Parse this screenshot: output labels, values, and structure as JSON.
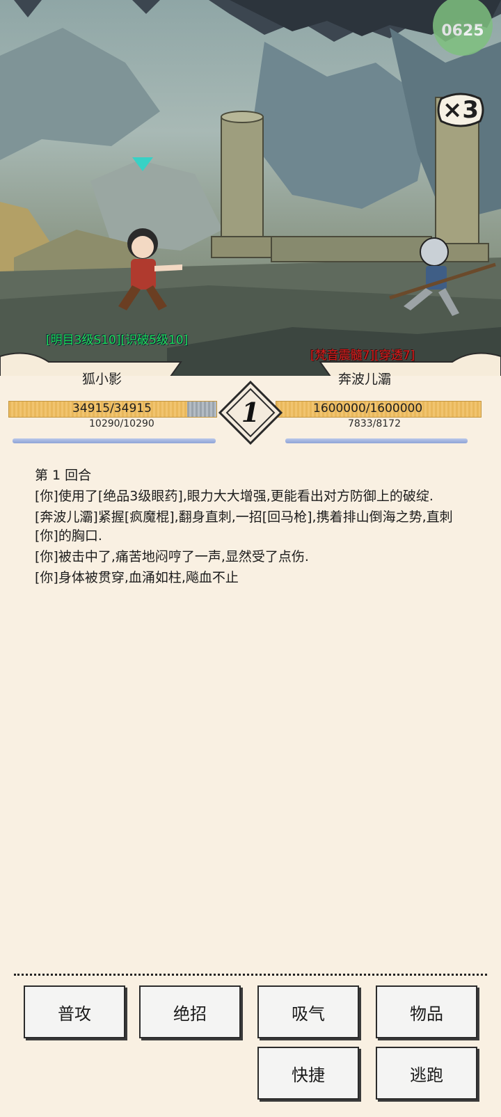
{
  "scene": {
    "speed_multiplier": "×3",
    "timer_text": "0625",
    "player_buffs": "[明目3级S10][识破5级10]",
    "enemy_buffs": "[梵音震髓7][穿透7]"
  },
  "player": {
    "name": "狐小影",
    "hp": "34915/34915",
    "hp_fraction": 0.86,
    "mp": "10290/10290",
    "mp_fraction": 1.0
  },
  "enemy": {
    "name": "奔波儿灞",
    "hp": "1600000/1600000",
    "hp_fraction": 1.0,
    "mp": "7833/8172",
    "mp_fraction": 0.96
  },
  "round": "1",
  "log": [
    "第 1 回合",
    "[你]使用了[绝品3级眼药],眼力大大增强,更能看出对方防御上的破绽.",
    "[奔波儿灞]紧握[疯魔棍],翻身直刺,一招[回马枪],携着排山倒海之势,直刺[你]的胸口.",
    "[你]被击中了,痛苦地闷哼了一声,显然受了点伤.",
    "[你]身体被贯穿,血涌如柱,飚血不止"
  ],
  "buttons": {
    "attack": "普攻",
    "ultimate": "绝招",
    "breathe": "吸气",
    "items": "物品",
    "shortcut": "快捷",
    "flee": "逃跑"
  },
  "colors": {
    "background": "#f9f0e2",
    "hp": "#f1c46f",
    "mp": "#8ea3d6",
    "player_buff": "#1fe05a",
    "enemy_buff": "#d61c1c"
  }
}
